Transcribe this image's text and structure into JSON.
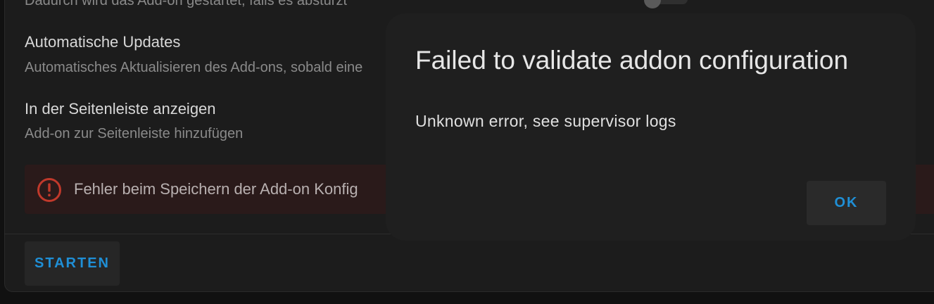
{
  "settings": {
    "watchdog_desc": "Dadurch wird das Add-on gestartet, falls es abstürzt",
    "auto_update_title": "Automatische Updates",
    "auto_update_desc": "Automatisches Aktualisieren des Add-ons, sobald eine",
    "sidebar_title": "In der Seitenleiste anzeigen",
    "sidebar_desc": "Add-on zur Seitenleiste hinzufügen"
  },
  "error_bar": {
    "icon": "alert-circle-icon",
    "text": "Fehler beim Speichern der Add-on Konfig"
  },
  "actions": {
    "start_label": "STARTEN"
  },
  "dialog": {
    "title": "Failed to validate addon configuration",
    "message": "Unknown error, see supervisor logs",
    "ok_label": "OK"
  },
  "colors": {
    "accent": "#1f8fd6",
    "error": "#c0392b",
    "background": "#111111",
    "card": "#1c1c1c",
    "dialog": "#1f1f1f"
  }
}
